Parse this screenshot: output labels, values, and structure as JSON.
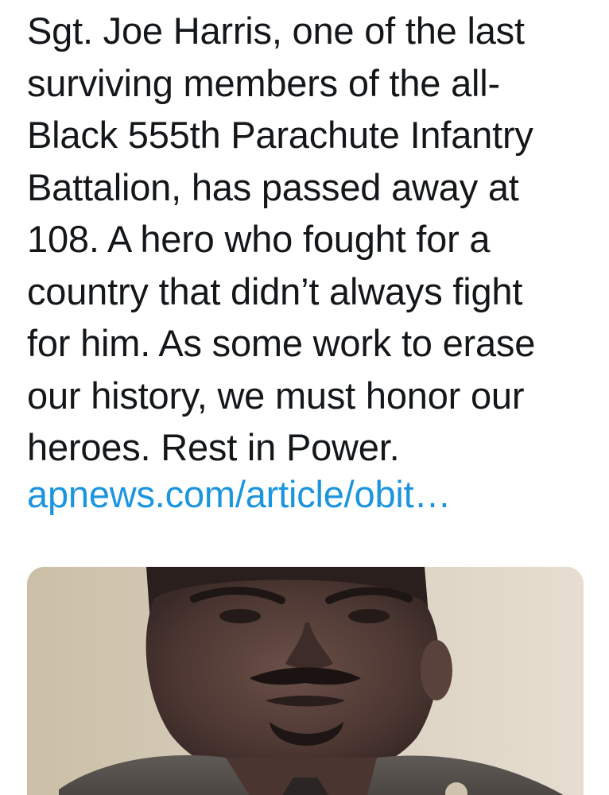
{
  "tweet": {
    "text_lines": [
      "Sgt. Joe Harris, one of the last",
      "surviving members of the all-",
      "Black 555th Parachute Infantry",
      "Battalion, has passed away at",
      "108. A hero who fought for a",
      "country that didn’t always fight",
      "for him. As some work to erase",
      "our history, we must honor our",
      "heroes. Rest in Power."
    ],
    "link_text": "apnews.com/article/obit…",
    "link_color": "#1b95e0",
    "text_color": "#14171a"
  },
  "media": {
    "kind": "photo",
    "subject": "portrait-photo"
  }
}
